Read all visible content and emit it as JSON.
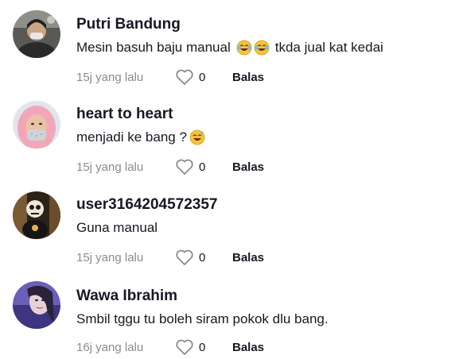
{
  "comments": [
    {
      "username": "Putri Bandung",
      "text_before": "Mesin basuh baju manual",
      "emoji": [
        "laughing-tears-emoji",
        "laughing-tears-emoji"
      ],
      "text_after": "tkda jual kat kedai",
      "time": "15j yang lalu",
      "likes": "0",
      "reply": "Balas"
    },
    {
      "username": "heart to heart",
      "text_before": "menjadi ke bang ?",
      "emoji": [
        "grinning-sweat-emoji"
      ],
      "text_after": "",
      "time": "15j yang lalu",
      "likes": "0",
      "reply": "Balas"
    },
    {
      "username": "user3164204572357",
      "text_before": "Guna manual",
      "emoji": [],
      "text_after": "",
      "time": "15j yang lalu",
      "likes": "0",
      "reply": "Balas"
    },
    {
      "username": "Wawa Ibrahim",
      "text_before": "Smbil tggu tu boleh siram pokok dlu bang.",
      "emoji": [],
      "text_after": "",
      "time": "16j yang lalu",
      "likes": "0",
      "reply": "Balas"
    }
  ],
  "colors": {
    "text": "#161823",
    "muted": "#8a8b91",
    "background": "#ffffff"
  }
}
